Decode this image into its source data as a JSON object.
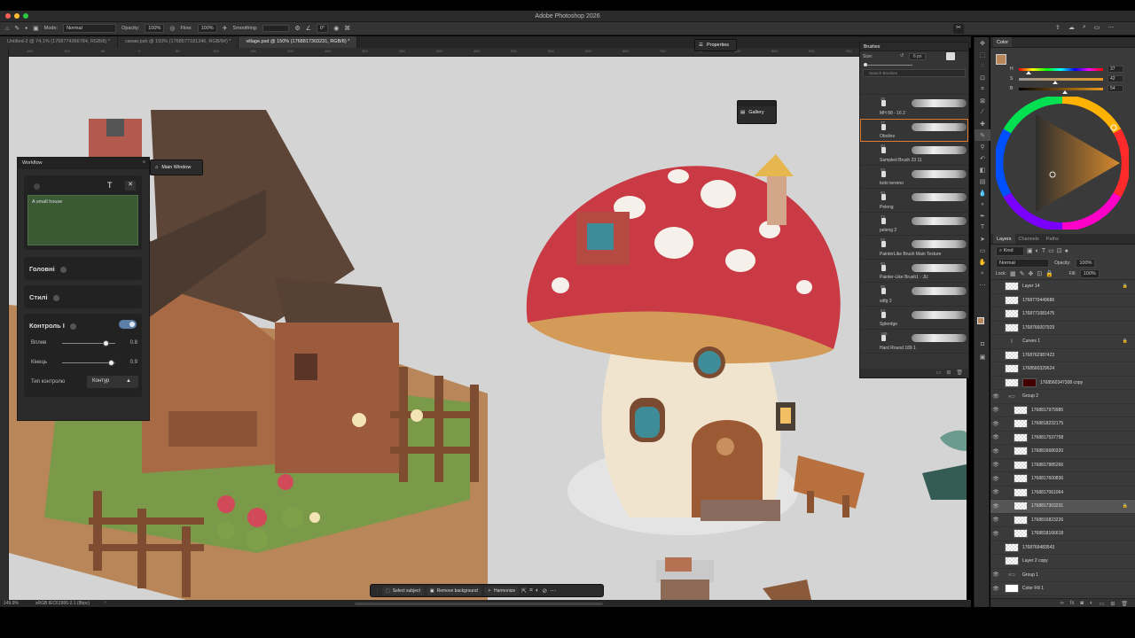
{
  "app": {
    "title": "Adobe Photoshop 2026"
  },
  "colors": {
    "canvas_bg": "#d4d4d4",
    "panel_bg": "#3a3a3a",
    "accent": "#2d8ceb",
    "titlebar": "#2b2b2b"
  },
  "options_bar": {
    "mode_label": "Mode:",
    "mode_value": "Normal",
    "opacity_label": "Opacity:",
    "opacity_value": "100%",
    "flow_label": "Flow:",
    "flow_value": "100%",
    "smoothing_label": "Smoothing:",
    "angle_value": "0°"
  },
  "tabs": [
    {
      "label": "Untitled-2 @ 74,1% (1768774366784, RGB/8) *"
    },
    {
      "label": "скеми.psb @ 150% (1768577181346, RGB/8#) *"
    },
    {
      "label": "village.psd @ 150% (1768817303231, RGB/8) *"
    }
  ],
  "ruler_ticks": [
    "150",
    "100",
    "50",
    "0",
    "50",
    "100",
    "150",
    "200",
    "250",
    "300",
    "350",
    "400",
    "450",
    "500",
    "550",
    "600",
    "650",
    "700",
    "750",
    "800",
    "850",
    "900",
    "950",
    "1000",
    "1050",
    "1100"
  ],
  "status": {
    "zoom": "149.9%",
    "profile": "sRGB IEC61966-2.1 (8bpc)"
  },
  "properties": {
    "label": "Properties"
  },
  "gallery": {
    "label": "Gallery"
  },
  "main_window": {
    "label": "Main Window"
  },
  "workflow": {
    "title": "Workflow",
    "prompt_text": "A small house",
    "section_main": "Головні",
    "section_styles": "Стилі",
    "control_label": "Контроль І",
    "influence_label": "Вплив",
    "influence_value": "0.8",
    "end_label": "Кінець",
    "end_value": "0.9",
    "control_type_label": "Тип контролю",
    "control_type_value": "Контур"
  },
  "brushes_panel": {
    "title": "Brushes",
    "size_label": "Size:",
    "size_value": "6 px",
    "search_placeholder": "Search Brushes",
    "brushes": [
      {
        "size": "25",
        "name": "MH 88 - 16 2"
      },
      {
        "size": "77",
        "name": "Oboline"
      },
      {
        "size": "20",
        "name": "Sampled Brush 23 11"
      },
      {
        "size": "93",
        "name": "todo terreno"
      },
      {
        "size": "80",
        "name": "Peleng"
      },
      {
        "size": "73",
        "name": "peleng 2"
      },
      {
        "size": "50",
        "name": "PainterLike Brush Main Texture"
      },
      {
        "size": "80",
        "name": "Painter-Like Brush1 - JU"
      },
      {
        "size": "85",
        "name": "sdfg 2"
      },
      {
        "size": "84",
        "name": "Splerdge"
      },
      {
        "size": "189",
        "name": "Hard Round 189 1"
      }
    ]
  },
  "color_panel": {
    "title": "Color",
    "channels": [
      {
        "label": "H",
        "value": "37",
        "fill": 0.1
      },
      {
        "label": "S",
        "value": "42",
        "fill": 0.42
      },
      {
        "label": "B",
        "value": "54",
        "fill": 0.54
      }
    ]
  },
  "layers_panel": {
    "tabs": [
      "Layers",
      "Channels",
      "Paths"
    ],
    "kind_label": "Kind",
    "blend_mode": "Normal",
    "opacity_label": "Opacity:",
    "opacity_value": "100%",
    "lock_label": "Lock:",
    "fill_label": "Fill:",
    "fill_value": "100%",
    "layers": [
      {
        "name": "Layer 14",
        "type": "layer",
        "indent": 0,
        "eye": false,
        "locked": true
      },
      {
        "name": "1768770449686",
        "type": "layer",
        "indent": 0,
        "eye": false,
        "locked": false
      },
      {
        "name": "1768771081475",
        "type": "layer",
        "indent": 0,
        "eye": false,
        "locked": false
      },
      {
        "name": "1768766007929",
        "type": "layer",
        "indent": 0,
        "eye": false,
        "locked": false
      },
      {
        "name": "Curves 1",
        "type": "adjustment",
        "indent": 0,
        "eye": false,
        "locked": true
      },
      {
        "name": "1768762987423",
        "type": "layer",
        "indent": 0,
        "eye": false,
        "locked": false
      },
      {
        "name": "1768560329624",
        "type": "layer",
        "indent": 0,
        "eye": false,
        "locked": false
      },
      {
        "name": "1768560347308 copy",
        "type": "masked",
        "indent": 0,
        "eye": false,
        "locked": false
      },
      {
        "name": "Group 2",
        "type": "group",
        "indent": 0,
        "eye": true,
        "locked": false
      },
      {
        "name": "1768817979985",
        "type": "layer",
        "indent": 1,
        "eye": true,
        "locked": false
      },
      {
        "name": "1768818232175",
        "type": "layer",
        "indent": 1,
        "eye": true,
        "locked": false
      },
      {
        "name": "1768817537758",
        "type": "layer",
        "indent": 1,
        "eye": true,
        "locked": false
      },
      {
        "name": "1768816680320",
        "type": "layer",
        "indent": 1,
        "eye": true,
        "locked": false
      },
      {
        "name": "1768817885266",
        "type": "layer",
        "indent": 1,
        "eye": true,
        "locked": false
      },
      {
        "name": "1768817600836",
        "type": "layer",
        "indent": 1,
        "eye": true,
        "locked": false
      },
      {
        "name": "1768817061064",
        "type": "layer",
        "indent": 1,
        "eye": true,
        "locked": false
      },
      {
        "name": "1768817303231",
        "type": "layer",
        "indent": 1,
        "eye": true,
        "locked": true,
        "selected": true
      },
      {
        "name": "1768816823226",
        "type": "layer",
        "indent": 1,
        "eye": true,
        "locked": false
      },
      {
        "name": "1768818166618",
        "type": "layer",
        "indent": 1,
        "eye": true,
        "locked": false
      },
      {
        "name": "1768769483543",
        "type": "layer",
        "indent": 0,
        "eye": false,
        "locked": false
      },
      {
        "name": "Layer 2 copy",
        "type": "layer",
        "indent": 0,
        "eye": false,
        "locked": false
      },
      {
        "name": "Group 1",
        "type": "group",
        "indent": 0,
        "eye": true,
        "locked": false
      },
      {
        "name": "Color Fill 1",
        "type": "fill",
        "indent": 0,
        "eye": true,
        "locked": false
      }
    ]
  },
  "contextual_bar": {
    "select_subject": "Select subject",
    "remove_background": "Remove background",
    "harmonize": "Harmonize"
  }
}
